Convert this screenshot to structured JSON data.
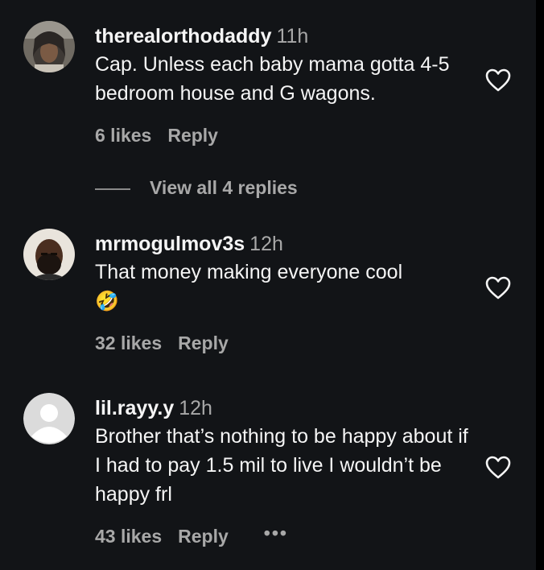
{
  "comments": [
    {
      "username": "therealorthodaddy",
      "time": "11h",
      "text": "Cap. Unless each baby mama gotta 4-5 bedroom house and G wagons.",
      "likes": "6 likes",
      "reply_label": "Reply",
      "view_replies": "View all 4 replies"
    },
    {
      "username": "mrmogulmov3s",
      "time": "12h",
      "text": "That money making everyone cool",
      "emoji": "🤣",
      "likes": "32 likes",
      "reply_label": "Reply"
    },
    {
      "username": "lil.rayy.y",
      "time": "12h",
      "text": "Brother that’s nothing to be happy about if I had to pay 1.5 mil to live I wouldn’t be happy frl",
      "likes": "43 likes",
      "reply_label": "Reply",
      "more_label": "•••"
    }
  ],
  "icons": {
    "like": "heart-outline-icon",
    "more": "more-options-icon"
  },
  "colors": {
    "background": "#121417",
    "text_primary": "#f5f5f5",
    "text_secondary": "#a8a8a8"
  }
}
